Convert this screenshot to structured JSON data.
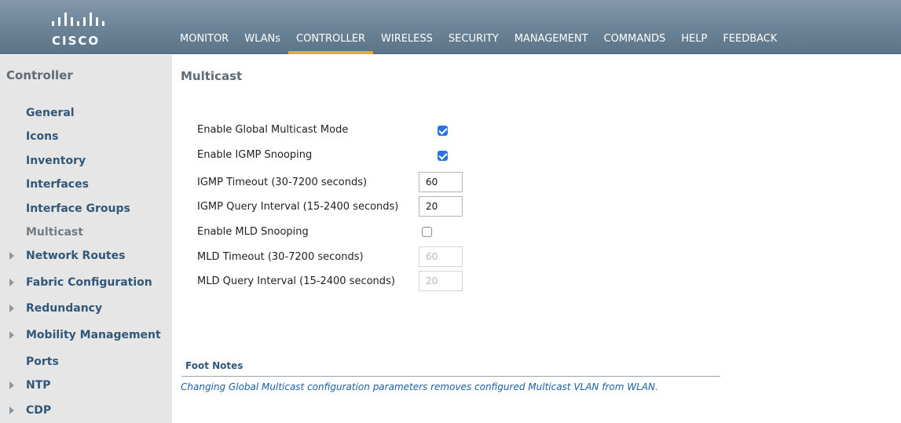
{
  "header": {
    "logo_text": "CISCO",
    "nav": [
      {
        "label": "MONITOR",
        "active": false
      },
      {
        "label": "WLANs",
        "active": false
      },
      {
        "label": "CONTROLLER",
        "active": true
      },
      {
        "label": "WIRELESS",
        "active": false
      },
      {
        "label": "SECURITY",
        "active": false
      },
      {
        "label": "MANAGEMENT",
        "active": false
      },
      {
        "label": "COMMANDS",
        "active": false
      },
      {
        "label": "HELP",
        "active": false
      },
      {
        "label": "FEEDBACK",
        "active": false
      }
    ],
    "colors": {
      "bar": "#6b8397",
      "active_underline": "#f0a23a"
    }
  },
  "sidebar": {
    "title": "Controller",
    "items": [
      {
        "label": "General",
        "expandable": false
      },
      {
        "label": "Icons",
        "expandable": false
      },
      {
        "label": "Inventory",
        "expandable": false
      },
      {
        "label": "Interfaces",
        "expandable": false
      },
      {
        "label": "Interface Groups",
        "expandable": false
      },
      {
        "label": "Multicast",
        "expandable": false,
        "selected": true
      },
      {
        "label": "Network Routes",
        "expandable": true
      },
      {
        "label": "Fabric Configuration",
        "expandable": true
      },
      {
        "label": "Redundancy",
        "expandable": true
      },
      {
        "label": "Mobility Management",
        "expandable": true
      },
      {
        "label": "Ports",
        "expandable": false
      },
      {
        "label": "NTP",
        "expandable": true
      },
      {
        "label": "CDP",
        "expandable": true
      }
    ]
  },
  "main": {
    "title": "Multicast",
    "fields": {
      "global_multicast": {
        "label": "Enable Global Multicast Mode",
        "checked": true
      },
      "igmp_snooping": {
        "label": "Enable IGMP Snooping",
        "checked": true
      },
      "igmp_timeout": {
        "label": "IGMP Timeout (30-7200 seconds)",
        "value": "60"
      },
      "igmp_query_interval": {
        "label": "IGMP Query Interval (15-2400 seconds)",
        "value": "20"
      },
      "mld_snooping": {
        "label": "Enable MLD Snooping",
        "checked": false
      },
      "mld_timeout": {
        "label": "MLD Timeout (30-7200 seconds)",
        "value": "60",
        "disabled": true
      },
      "mld_query_interval": {
        "label": "MLD Query Interval (15-2400 seconds)",
        "value": "20",
        "disabled": true
      }
    },
    "foot_notes": {
      "title": "Foot Notes",
      "text": "Changing Global Multicast configuration parameters removes configured Multicast VLAN from WLAN."
    }
  }
}
